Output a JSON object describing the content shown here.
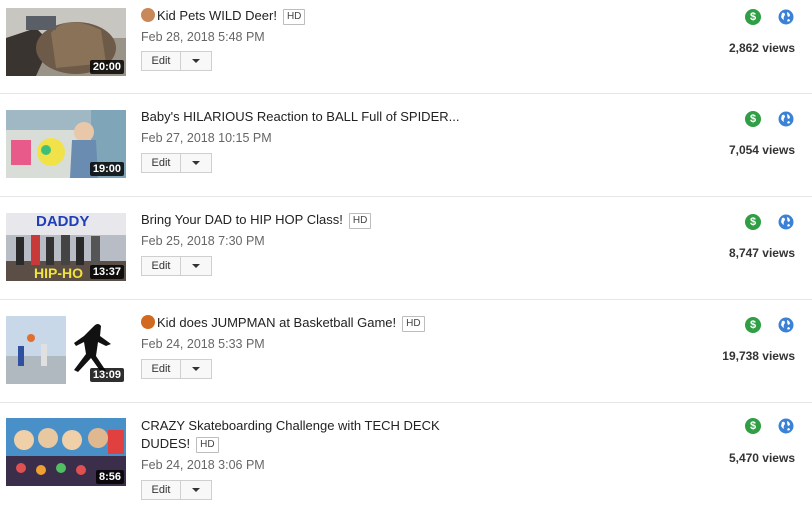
{
  "videos": [
    {
      "title": "Kid Pets WILD Deer!",
      "title_icon": "person-emoji-icon",
      "title_icon_color": "#c9885a",
      "hd": "HD",
      "date": "Feb 28, 2018 5:48 PM",
      "duration": "20:00",
      "edit_label": "Edit",
      "views": "2,862 views"
    },
    {
      "title": "Baby's HILARIOUS Reaction to BALL Full of SPIDER...",
      "date": "Feb 27, 2018 10:15 PM",
      "duration": "19:00",
      "edit_label": "Edit",
      "views": "7,054 views"
    },
    {
      "title": "Bring Your DAD to HIP HOP Class!",
      "hd": "HD",
      "date": "Feb 25, 2018 7:30 PM",
      "duration": "13:37",
      "thumb_text_top": "DADDY",
      "thumb_text_bottom": "HIP-HO",
      "edit_label": "Edit",
      "views": "8,747 views"
    },
    {
      "title": "Kid does JUMPMAN at Basketball Game!",
      "title_icon": "basketball-emoji-icon",
      "title_icon_color": "#d2691e",
      "hd": "HD",
      "date": "Feb 24, 2018 5:33 PM",
      "duration": "13:09",
      "edit_label": "Edit",
      "views": "19,738 views"
    },
    {
      "title_line1": "CRAZY Skateboarding Challenge with TECH DECK",
      "title_line2": "DUDES!",
      "hd": "HD",
      "date": "Feb 24, 2018 3:06 PM",
      "duration": "8:56",
      "edit_label": "Edit",
      "views": "5,470 views"
    }
  ],
  "colors": {
    "monetization": "#2f9e44",
    "visibility_public": "#3b82d6"
  },
  "icons": {
    "monetization": "dollar-icon",
    "visibility": "globe-icon"
  },
  "monetization_symbol": "$"
}
